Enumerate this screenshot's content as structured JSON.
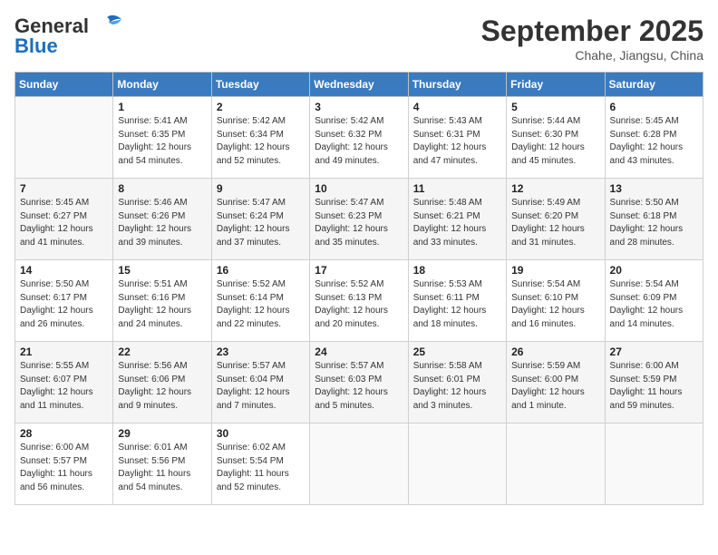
{
  "header": {
    "logo_general": "General",
    "logo_blue": "Blue",
    "month_year": "September 2025",
    "location": "Chahe, Jiangsu, China"
  },
  "days_of_week": [
    "Sunday",
    "Monday",
    "Tuesday",
    "Wednesday",
    "Thursday",
    "Friday",
    "Saturday"
  ],
  "weeks": [
    [
      {
        "num": "",
        "info": ""
      },
      {
        "num": "1",
        "info": "Sunrise: 5:41 AM\nSunset: 6:35 PM\nDaylight: 12 hours\nand 54 minutes."
      },
      {
        "num": "2",
        "info": "Sunrise: 5:42 AM\nSunset: 6:34 PM\nDaylight: 12 hours\nand 52 minutes."
      },
      {
        "num": "3",
        "info": "Sunrise: 5:42 AM\nSunset: 6:32 PM\nDaylight: 12 hours\nand 49 minutes."
      },
      {
        "num": "4",
        "info": "Sunrise: 5:43 AM\nSunset: 6:31 PM\nDaylight: 12 hours\nand 47 minutes."
      },
      {
        "num": "5",
        "info": "Sunrise: 5:44 AM\nSunset: 6:30 PM\nDaylight: 12 hours\nand 45 minutes."
      },
      {
        "num": "6",
        "info": "Sunrise: 5:45 AM\nSunset: 6:28 PM\nDaylight: 12 hours\nand 43 minutes."
      }
    ],
    [
      {
        "num": "7",
        "info": "Sunrise: 5:45 AM\nSunset: 6:27 PM\nDaylight: 12 hours\nand 41 minutes."
      },
      {
        "num": "8",
        "info": "Sunrise: 5:46 AM\nSunset: 6:26 PM\nDaylight: 12 hours\nand 39 minutes."
      },
      {
        "num": "9",
        "info": "Sunrise: 5:47 AM\nSunset: 6:24 PM\nDaylight: 12 hours\nand 37 minutes."
      },
      {
        "num": "10",
        "info": "Sunrise: 5:47 AM\nSunset: 6:23 PM\nDaylight: 12 hours\nand 35 minutes."
      },
      {
        "num": "11",
        "info": "Sunrise: 5:48 AM\nSunset: 6:21 PM\nDaylight: 12 hours\nand 33 minutes."
      },
      {
        "num": "12",
        "info": "Sunrise: 5:49 AM\nSunset: 6:20 PM\nDaylight: 12 hours\nand 31 minutes."
      },
      {
        "num": "13",
        "info": "Sunrise: 5:50 AM\nSunset: 6:18 PM\nDaylight: 12 hours\nand 28 minutes."
      }
    ],
    [
      {
        "num": "14",
        "info": "Sunrise: 5:50 AM\nSunset: 6:17 PM\nDaylight: 12 hours\nand 26 minutes."
      },
      {
        "num": "15",
        "info": "Sunrise: 5:51 AM\nSunset: 6:16 PM\nDaylight: 12 hours\nand 24 minutes."
      },
      {
        "num": "16",
        "info": "Sunrise: 5:52 AM\nSunset: 6:14 PM\nDaylight: 12 hours\nand 22 minutes."
      },
      {
        "num": "17",
        "info": "Sunrise: 5:52 AM\nSunset: 6:13 PM\nDaylight: 12 hours\nand 20 minutes."
      },
      {
        "num": "18",
        "info": "Sunrise: 5:53 AM\nSunset: 6:11 PM\nDaylight: 12 hours\nand 18 minutes."
      },
      {
        "num": "19",
        "info": "Sunrise: 5:54 AM\nSunset: 6:10 PM\nDaylight: 12 hours\nand 16 minutes."
      },
      {
        "num": "20",
        "info": "Sunrise: 5:54 AM\nSunset: 6:09 PM\nDaylight: 12 hours\nand 14 minutes."
      }
    ],
    [
      {
        "num": "21",
        "info": "Sunrise: 5:55 AM\nSunset: 6:07 PM\nDaylight: 12 hours\nand 11 minutes."
      },
      {
        "num": "22",
        "info": "Sunrise: 5:56 AM\nSunset: 6:06 PM\nDaylight: 12 hours\nand 9 minutes."
      },
      {
        "num": "23",
        "info": "Sunrise: 5:57 AM\nSunset: 6:04 PM\nDaylight: 12 hours\nand 7 minutes."
      },
      {
        "num": "24",
        "info": "Sunrise: 5:57 AM\nSunset: 6:03 PM\nDaylight: 12 hours\nand 5 minutes."
      },
      {
        "num": "25",
        "info": "Sunrise: 5:58 AM\nSunset: 6:01 PM\nDaylight: 12 hours\nand 3 minutes."
      },
      {
        "num": "26",
        "info": "Sunrise: 5:59 AM\nSunset: 6:00 PM\nDaylight: 12 hours\nand 1 minute."
      },
      {
        "num": "27",
        "info": "Sunrise: 6:00 AM\nSunset: 5:59 PM\nDaylight: 11 hours\nand 59 minutes."
      }
    ],
    [
      {
        "num": "28",
        "info": "Sunrise: 6:00 AM\nSunset: 5:57 PM\nDaylight: 11 hours\nand 56 minutes."
      },
      {
        "num": "29",
        "info": "Sunrise: 6:01 AM\nSunset: 5:56 PM\nDaylight: 11 hours\nand 54 minutes."
      },
      {
        "num": "30",
        "info": "Sunrise: 6:02 AM\nSunset: 5:54 PM\nDaylight: 11 hours\nand 52 minutes."
      },
      {
        "num": "",
        "info": ""
      },
      {
        "num": "",
        "info": ""
      },
      {
        "num": "",
        "info": ""
      },
      {
        "num": "",
        "info": ""
      }
    ]
  ]
}
